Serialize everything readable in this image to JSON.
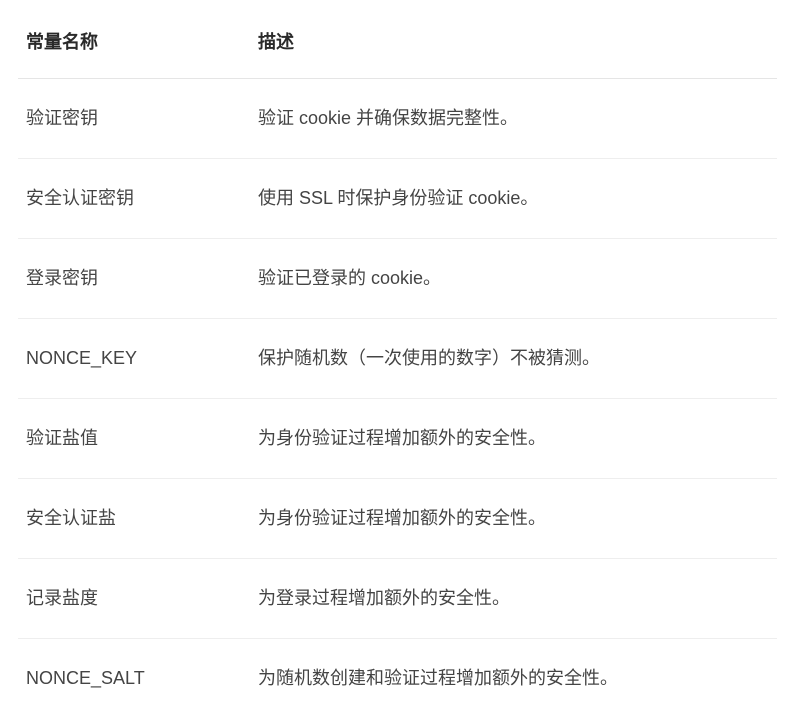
{
  "table": {
    "headers": {
      "name": "常量名称",
      "description": "描述"
    },
    "rows": [
      {
        "name": "验证密钥",
        "description": "验证 cookie 并确保数据完整性。"
      },
      {
        "name": "安全认证密钥",
        "description": "使用 SSL 时保护身份验证 cookie。"
      },
      {
        "name": "登录密钥",
        "description": "验证已登录的 cookie。"
      },
      {
        "name": "NONCE_KEY",
        "description": "保护随机数（一次使用的数字）不被猜测。"
      },
      {
        "name": "验证盐值",
        "description": "为身份验证过程增加额外的安全性。"
      },
      {
        "name": "安全认证盐",
        "description": "为身份验证过程增加额外的安全性。"
      },
      {
        "name": "记录盐度",
        "description": "为登录过程增加额外的安全性。"
      },
      {
        "name": "NONCE_SALT",
        "description": "为随机数创建和验证过程增加额外的安全性。"
      }
    ]
  }
}
